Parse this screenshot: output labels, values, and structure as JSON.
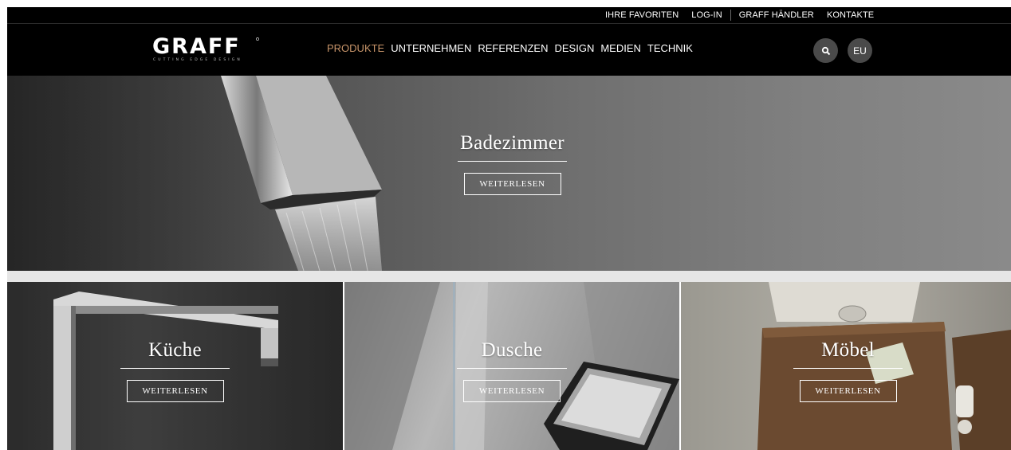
{
  "topbar": {
    "links": [
      "IHRE FAVORITEN",
      "LOG-IN",
      "GRAFF HÄNDLER",
      "KONTAKTE"
    ]
  },
  "header": {
    "logo_text": "GRAFF",
    "logo_tagline": "CUTTING EDGE DESIGN",
    "nav": [
      "PRODUKTE",
      "UNTERNEHMEN",
      "REFERENZEN",
      "DESIGN",
      "MEDIEN",
      "TECHNIK"
    ],
    "active_nav": "PRODUKTE",
    "search_icon": "search-icon",
    "region_label": "EU"
  },
  "hero": {
    "title": "Badezimmer",
    "button": "WEITERLESEN"
  },
  "panels": [
    {
      "title": "Küche",
      "button": "WEITERLESEN"
    },
    {
      "title": "Dusche",
      "button": "WEITERLESEN"
    },
    {
      "title": "Möbel",
      "button": "WEITERLESEN"
    }
  ],
  "colors": {
    "topbar_bg": "#000000",
    "nav_active": "#c8956a",
    "circle_button": "#4a4a4a",
    "spacer": "#e6e6e6"
  }
}
